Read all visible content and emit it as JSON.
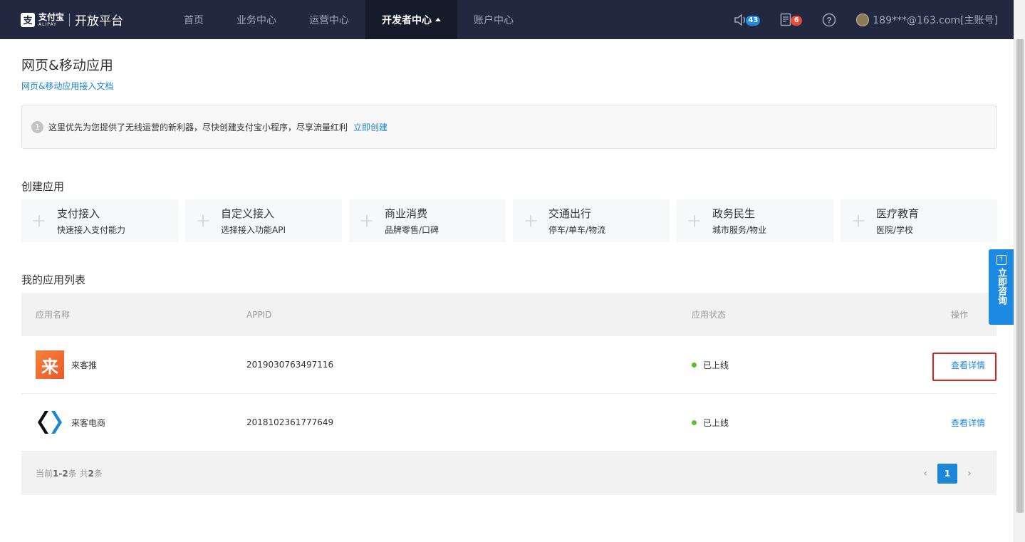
{
  "header": {
    "logo_cn": "支付宝",
    "logo_en": "ALIPAY",
    "platform_title": "开放平台",
    "nav": [
      {
        "label": "首页"
      },
      {
        "label": "业务中心"
      },
      {
        "label": "运营中心"
      },
      {
        "label": "开发者中心",
        "active": true
      },
      {
        "label": "账户中心"
      }
    ],
    "announcements_count": "43",
    "tasks_count": "6",
    "help_label": "?",
    "user_account": "189***@163.com[主账号]"
  },
  "page": {
    "title": "网页&移动应用",
    "doc_link": "网页&移动应用接入文档"
  },
  "notice": {
    "icon_text": "1",
    "text": "这里优先为您提供了无线运营的新利器，尽快创建支付宝小程序，尽享流量红利",
    "link": "立即创建"
  },
  "create": {
    "title": "创建应用",
    "cards": [
      {
        "title": "支付接入",
        "sub": "快速接入支付能力"
      },
      {
        "title": "自定义接入",
        "sub": "选择接入功能API"
      },
      {
        "title": "商业消费",
        "sub": "品牌零售/口碑"
      },
      {
        "title": "交通出行",
        "sub": "停车/单车/物流"
      },
      {
        "title": "政务民生",
        "sub": "城市服务/物业"
      },
      {
        "title": "医疗教育",
        "sub": "医院/学校"
      }
    ]
  },
  "apps": {
    "title": "我的应用列表",
    "columns": {
      "name": "应用名称",
      "appid": "APPID",
      "status": "应用状态",
      "action": "操作"
    },
    "rows": [
      {
        "icon_char": "来",
        "name": "来客推",
        "appid": "2019030763497116",
        "status": "已上线",
        "action": "查看详情"
      },
      {
        "name": "来客电商",
        "appid": "2018102361777649",
        "status": "已上线",
        "action": "查看详情"
      }
    ],
    "footer": {
      "prefix": "当前",
      "range": "1-2",
      "middle": "条 共",
      "total": "2",
      "suffix": "条"
    },
    "pager": {
      "prev": "‹",
      "current": "1",
      "next": "›"
    }
  },
  "consult": {
    "icon_text": "?",
    "label": "立即咨询"
  },
  "colors": {
    "nav_bg": "#222840",
    "accent": "#1c86d8",
    "status_online": "#60c22a",
    "highlight": "#e0201c"
  }
}
